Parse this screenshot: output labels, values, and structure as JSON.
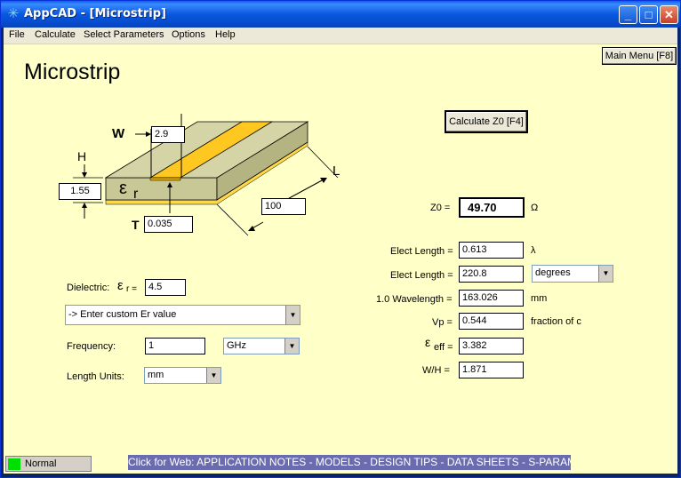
{
  "window": {
    "title": "AppCAD - [Microstrip]",
    "app_icon": "asterisk-icon",
    "controls": {
      "minimize": "_",
      "maximize": "□",
      "close": "✕"
    }
  },
  "menu": [
    "File",
    "Calculate",
    "Select Parameters",
    "Options",
    "Help"
  ],
  "page": {
    "title": "Microstrip",
    "main_menu_button": "Main Menu [F8]",
    "calculate_button": "Calculate Z0  [F4]"
  },
  "diagram": {
    "labels": {
      "w": "W",
      "h": "H",
      "t": "T",
      "l": "L",
      "er_symbol": "ε",
      "er_sub": "r"
    },
    "w_value": "2.9",
    "h_value": "1.55",
    "t_value": "0.035",
    "l_value": "100",
    "colors": {
      "substrate": "#c8c896",
      "strip": "#ffc820",
      "ground": "#ffd84a"
    }
  },
  "inputs": {
    "dielectric_label": "Dielectric:",
    "er_label_symbol": "ε",
    "er_label_sub": "r =",
    "er_value": "4.5",
    "dielectric_select": "-> Enter custom Er value",
    "frequency_label": "Frequency:",
    "frequency_value": "1",
    "frequency_unit": "GHz",
    "length_units_label": "Length Units:",
    "length_units_value": "mm"
  },
  "results": {
    "z0_label": "Z0 =",
    "z0_value": "49.70",
    "z0_unit": "Ω",
    "elect_length_1_label": "Elect Length =",
    "elect_length_1_value": "0.613",
    "elect_length_1_unit": "λ",
    "elect_length_2_label": "Elect Length =",
    "elect_length_2_value": "220.8",
    "elect_length_2_unit": "degrees",
    "wavelength_label": "1.0 Wavelength =",
    "wavelength_value": "163.026",
    "wavelength_unit": "mm",
    "vp_label": "Vp =",
    "vp_value": "0.544",
    "vp_unit": "fraction of c",
    "eeff_symbol": "ε",
    "eeff_sub": "eff =",
    "eeff_value": "3.382",
    "wh_label": "W/H =",
    "wh_value": "1.871"
  },
  "status": {
    "mode": "Normal",
    "indicator_color": "#00e000",
    "web_bar": "Click for Web: APPLICATION NOTES - MODELS - DESIGN TIPS - DATA SHEETS - S-PARAMETERS",
    "web_bar_color": "#6b6bb0"
  }
}
